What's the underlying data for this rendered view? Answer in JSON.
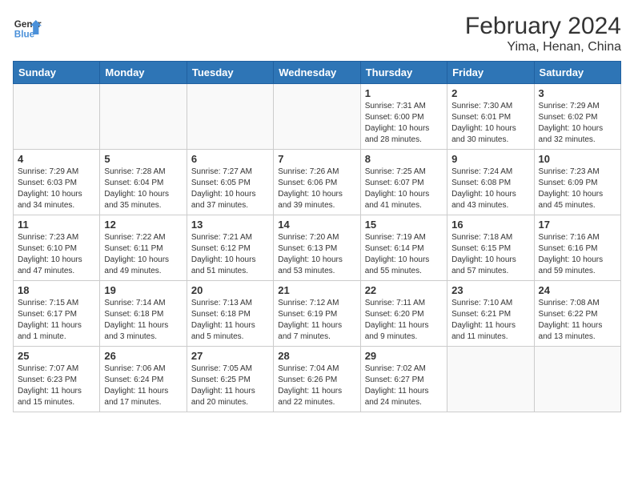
{
  "header": {
    "logo_text_general": "General",
    "logo_text_blue": "Blue",
    "title": "February 2024",
    "subtitle": "Yima, Henan, China"
  },
  "weekdays": [
    "Sunday",
    "Monday",
    "Tuesday",
    "Wednesday",
    "Thursday",
    "Friday",
    "Saturday"
  ],
  "weeks": [
    [
      {
        "day": "",
        "info": ""
      },
      {
        "day": "",
        "info": ""
      },
      {
        "day": "",
        "info": ""
      },
      {
        "day": "",
        "info": ""
      },
      {
        "day": "1",
        "info": "Sunrise: 7:31 AM\nSunset: 6:00 PM\nDaylight: 10 hours and 28 minutes."
      },
      {
        "day": "2",
        "info": "Sunrise: 7:30 AM\nSunset: 6:01 PM\nDaylight: 10 hours and 30 minutes."
      },
      {
        "day": "3",
        "info": "Sunrise: 7:29 AM\nSunset: 6:02 PM\nDaylight: 10 hours and 32 minutes."
      }
    ],
    [
      {
        "day": "4",
        "info": "Sunrise: 7:29 AM\nSunset: 6:03 PM\nDaylight: 10 hours and 34 minutes."
      },
      {
        "day": "5",
        "info": "Sunrise: 7:28 AM\nSunset: 6:04 PM\nDaylight: 10 hours and 35 minutes."
      },
      {
        "day": "6",
        "info": "Sunrise: 7:27 AM\nSunset: 6:05 PM\nDaylight: 10 hours and 37 minutes."
      },
      {
        "day": "7",
        "info": "Sunrise: 7:26 AM\nSunset: 6:06 PM\nDaylight: 10 hours and 39 minutes."
      },
      {
        "day": "8",
        "info": "Sunrise: 7:25 AM\nSunset: 6:07 PM\nDaylight: 10 hours and 41 minutes."
      },
      {
        "day": "9",
        "info": "Sunrise: 7:24 AM\nSunset: 6:08 PM\nDaylight: 10 hours and 43 minutes."
      },
      {
        "day": "10",
        "info": "Sunrise: 7:23 AM\nSunset: 6:09 PM\nDaylight: 10 hours and 45 minutes."
      }
    ],
    [
      {
        "day": "11",
        "info": "Sunrise: 7:23 AM\nSunset: 6:10 PM\nDaylight: 10 hours and 47 minutes."
      },
      {
        "day": "12",
        "info": "Sunrise: 7:22 AM\nSunset: 6:11 PM\nDaylight: 10 hours and 49 minutes."
      },
      {
        "day": "13",
        "info": "Sunrise: 7:21 AM\nSunset: 6:12 PM\nDaylight: 10 hours and 51 minutes."
      },
      {
        "day": "14",
        "info": "Sunrise: 7:20 AM\nSunset: 6:13 PM\nDaylight: 10 hours and 53 minutes."
      },
      {
        "day": "15",
        "info": "Sunrise: 7:19 AM\nSunset: 6:14 PM\nDaylight: 10 hours and 55 minutes."
      },
      {
        "day": "16",
        "info": "Sunrise: 7:18 AM\nSunset: 6:15 PM\nDaylight: 10 hours and 57 minutes."
      },
      {
        "day": "17",
        "info": "Sunrise: 7:16 AM\nSunset: 6:16 PM\nDaylight: 10 hours and 59 minutes."
      }
    ],
    [
      {
        "day": "18",
        "info": "Sunrise: 7:15 AM\nSunset: 6:17 PM\nDaylight: 11 hours and 1 minute."
      },
      {
        "day": "19",
        "info": "Sunrise: 7:14 AM\nSunset: 6:18 PM\nDaylight: 11 hours and 3 minutes."
      },
      {
        "day": "20",
        "info": "Sunrise: 7:13 AM\nSunset: 6:18 PM\nDaylight: 11 hours and 5 minutes."
      },
      {
        "day": "21",
        "info": "Sunrise: 7:12 AM\nSunset: 6:19 PM\nDaylight: 11 hours and 7 minutes."
      },
      {
        "day": "22",
        "info": "Sunrise: 7:11 AM\nSunset: 6:20 PM\nDaylight: 11 hours and 9 minutes."
      },
      {
        "day": "23",
        "info": "Sunrise: 7:10 AM\nSunset: 6:21 PM\nDaylight: 11 hours and 11 minutes."
      },
      {
        "day": "24",
        "info": "Sunrise: 7:08 AM\nSunset: 6:22 PM\nDaylight: 11 hours and 13 minutes."
      }
    ],
    [
      {
        "day": "25",
        "info": "Sunrise: 7:07 AM\nSunset: 6:23 PM\nDaylight: 11 hours and 15 minutes."
      },
      {
        "day": "26",
        "info": "Sunrise: 7:06 AM\nSunset: 6:24 PM\nDaylight: 11 hours and 17 minutes."
      },
      {
        "day": "27",
        "info": "Sunrise: 7:05 AM\nSunset: 6:25 PM\nDaylight: 11 hours and 20 minutes."
      },
      {
        "day": "28",
        "info": "Sunrise: 7:04 AM\nSunset: 6:26 PM\nDaylight: 11 hours and 22 minutes."
      },
      {
        "day": "29",
        "info": "Sunrise: 7:02 AM\nSunset: 6:27 PM\nDaylight: 11 hours and 24 minutes."
      },
      {
        "day": "",
        "info": ""
      },
      {
        "day": "",
        "info": ""
      }
    ]
  ]
}
